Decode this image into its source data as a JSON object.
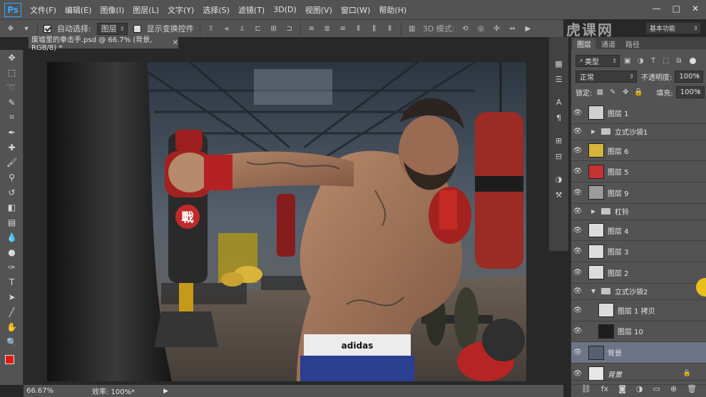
{
  "app": {
    "logo": "Ps"
  },
  "menu": [
    "文件(F)",
    "编辑(E)",
    "图像(I)",
    "图层(L)",
    "文字(Y)",
    "选择(S)",
    "滤镜(T)",
    "3D(D)",
    "视图(V)",
    "窗口(W)",
    "帮助(H)"
  ],
  "window_buttons": [
    "—",
    "□",
    "✕"
  ],
  "options": {
    "auto_select_label": "自动选择:",
    "auto_select_value": "图层",
    "show_transform_label": "显示变换控件",
    "mode_3d_label": "3D 模式:",
    "workspace_value": "基本功能"
  },
  "document": {
    "tab_title": "废墟里的拳击手.psd @ 66.7% (背景, RGB/8) *"
  },
  "status": {
    "zoom": "66.67%",
    "efficiency": "效率: 100%*"
  },
  "canvas_content": {
    "bag_emblem": "戰",
    "adidas": "adidas"
  },
  "watermark": "虎课网",
  "panel": {
    "tabs": [
      "图层",
      "通道",
      "路径"
    ],
    "filter_kind": "类型",
    "blend_mode": "正常",
    "opacity_label": "不透明度:",
    "opacity_value": "100%",
    "lock_label": "锁定:",
    "fill_label": "填充:",
    "fill_value": "100%"
  },
  "layers": [
    {
      "name": "图层 1",
      "type": "layer",
      "thumb": "#cfcfcf"
    },
    {
      "name": "立式沙袋1",
      "type": "group",
      "arrow": "▶"
    },
    {
      "name": "图层 6",
      "type": "layer",
      "thumb": "#d7b43a"
    },
    {
      "name": "图层 5",
      "type": "layer",
      "thumb": "#c43232"
    },
    {
      "name": "图层 9",
      "type": "layer",
      "thumb": "#9b9b9b"
    },
    {
      "name": "杠铃",
      "type": "group",
      "arrow": "▶"
    },
    {
      "name": "图层 4",
      "type": "smart",
      "thumb": "#dcdcdc"
    },
    {
      "name": "图层 3",
      "type": "smart",
      "thumb": "#dcdcdc"
    },
    {
      "name": "图层 2",
      "type": "smart",
      "thumb": "#dcdcdc"
    },
    {
      "name": "立式沙袋2",
      "type": "group",
      "arrow": "▼"
    },
    {
      "name": "图层 1 拷贝",
      "type": "smart",
      "thumb": "#dcdcdc",
      "indent": true
    },
    {
      "name": "图层 10",
      "type": "layer",
      "thumb": "#1e1e1e",
      "indent": true
    },
    {
      "name": "背景",
      "type": "layer",
      "thumb": "#566070",
      "selected": true
    },
    {
      "name": "背景",
      "type": "locked",
      "thumb": "#e6e6e6"
    }
  ],
  "panel_footer_icons": [
    "link-icon",
    "fx-icon",
    "mask-icon",
    "adjustment-icon",
    "folder-icon",
    "new-layer-icon",
    "trash-icon"
  ]
}
